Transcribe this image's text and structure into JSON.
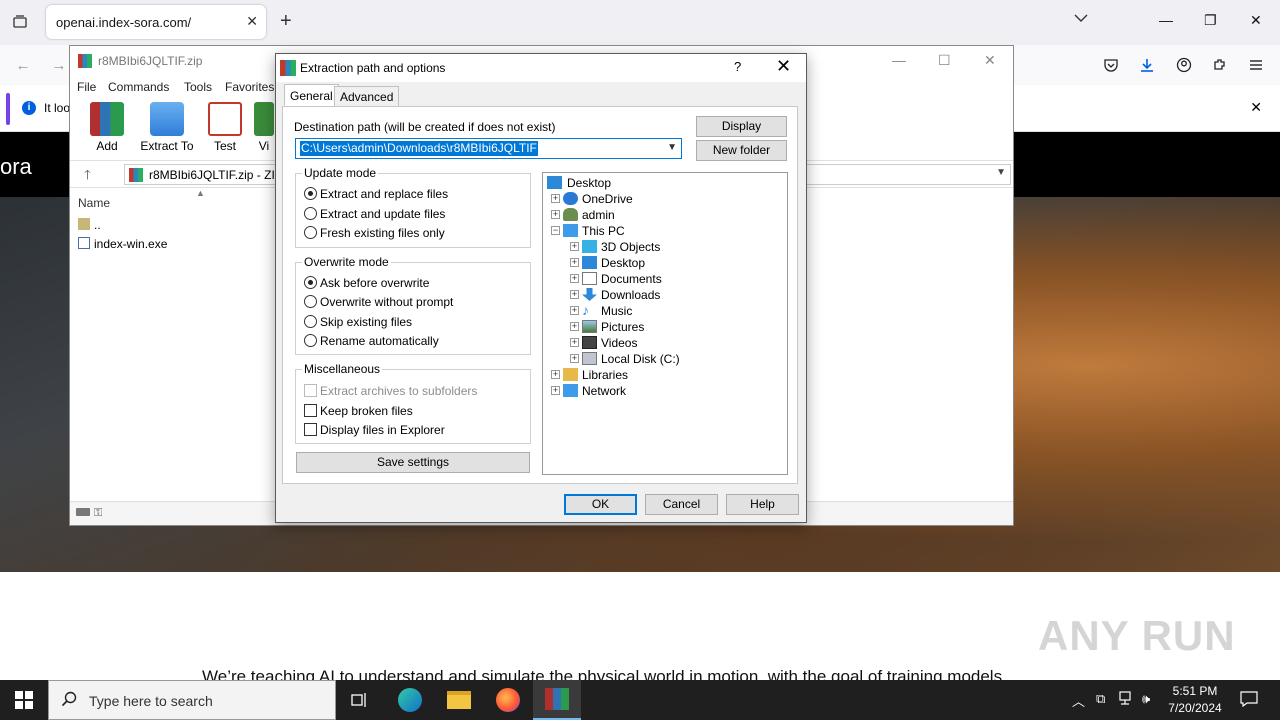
{
  "browser": {
    "tab_title": "openai.index-sora.com/",
    "tab_close": "✕",
    "new_tab": "+",
    "tabs_menu": "⌵",
    "minimize": "—",
    "restore": "❐",
    "close": "✕"
  },
  "notification": {
    "text": "It loo",
    "close": "✕"
  },
  "page": {
    "brand": "ora",
    "tagline": "We’re teaching AI to understand and simulate the physical world in motion, with the goal of training models",
    "watermark": "ANY RUN"
  },
  "winrar": {
    "title": "r8MBIbi6JQLTIF.zip",
    "menu": [
      "File",
      "Commands",
      "Tools",
      "Favorites"
    ],
    "toolbar": [
      "Add",
      "Extract To",
      "Test",
      "Vi"
    ],
    "address": "r8MBIbi6JQLTIF.zip - ZIP",
    "column_name": "Name",
    "files": [
      "..",
      "index-win.exe"
    ],
    "minimize": "—",
    "maximize": "☐",
    "close": "✕"
  },
  "dialog": {
    "title": "Extraction path and options",
    "help": "?",
    "close": "✕",
    "tabs": [
      "General",
      "Advanced"
    ],
    "dest_label": "Destination path (will be created if does not exist)",
    "dest_value": "C:\\Users\\admin\\Downloads\\r8MBIbi6JQLTIF",
    "display_btn": "Display",
    "newfolder_btn": "New folder",
    "update_mode": {
      "title": "Update mode",
      "options": [
        "Extract and replace files",
        "Extract and update files",
        "Fresh existing files only"
      ],
      "selected": 0
    },
    "overwrite_mode": {
      "title": "Overwrite mode",
      "options": [
        "Ask before overwrite",
        "Overwrite without prompt",
        "Skip existing files",
        "Rename automatically"
      ],
      "selected": 0
    },
    "misc": {
      "title": "Miscellaneous",
      "options": [
        "Extract archives to subfolders",
        "Keep broken files",
        "Display files in Explorer"
      ]
    },
    "save_settings": "Save settings",
    "tree": [
      "Desktop",
      "OneDrive",
      "admin",
      "This PC",
      "3D Objects",
      "Desktop",
      "Documents",
      "Downloads",
      "Music",
      "Pictures",
      "Videos",
      "Local Disk (C:)",
      "Libraries",
      "Network"
    ],
    "ok": "OK",
    "cancel": "Cancel",
    "help_btn": "Help"
  },
  "taskbar": {
    "search_placeholder": "Type here to search",
    "time": "5:51 PM",
    "date": "7/20/2024"
  },
  "colors": {
    "accent_blue": "#0078d7",
    "taskbar_bg": "#1f1f1f",
    "firefox_accent": "#7542e5"
  }
}
